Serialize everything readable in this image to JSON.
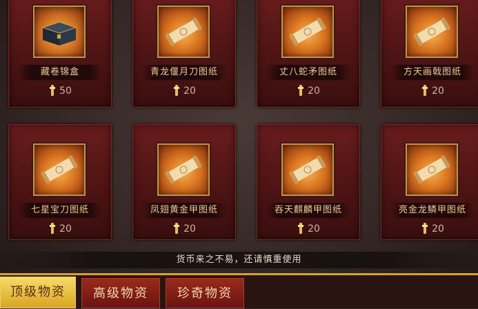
{
  "items": [
    {
      "name": "藏卷锦盒",
      "cost": "50",
      "icon": "box-icon"
    },
    {
      "name": "青龙偃月刀图纸",
      "cost": "20",
      "icon": "scroll-icon"
    },
    {
      "name": "丈八蛇矛图纸",
      "cost": "20",
      "icon": "scroll-icon"
    },
    {
      "name": "方天画戟图纸",
      "cost": "20",
      "icon": "scroll-icon"
    },
    {
      "name": "七星宝刀图纸",
      "cost": "20",
      "icon": "scroll-icon"
    },
    {
      "name": "凤翅黄金甲图纸",
      "cost": "20",
      "icon": "scroll-icon"
    },
    {
      "name": "吞天麒麟甲图纸",
      "cost": "20",
      "icon": "scroll-icon"
    },
    {
      "name": "亮金龙鳞甲图纸",
      "cost": "20",
      "icon": "scroll-icon"
    }
  ],
  "notice": "货币来之不易，还请慎重使用",
  "tabs": [
    {
      "label": "顶级物资",
      "active": true
    },
    {
      "label": "高级物资",
      "active": false
    },
    {
      "label": "珍奇物资",
      "active": false
    }
  ],
  "colors": {
    "accent": "#d9a520",
    "card": "#5a1818",
    "name_text": "#f0c890"
  }
}
